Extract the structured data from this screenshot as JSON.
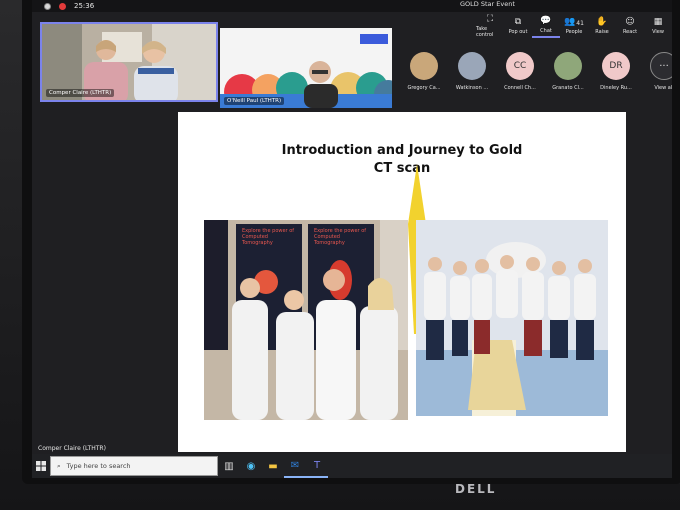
{
  "meeting": {
    "timer": "25:36",
    "title": "GOLD Star Event"
  },
  "toolbar": [
    {
      "label": "Take control",
      "icon": "take-control-icon",
      "glyph": "⛶",
      "active": false
    },
    {
      "label": "Pop out",
      "icon": "pop-out-icon",
      "glyph": "⧉",
      "active": false
    },
    {
      "label": "Chat",
      "icon": "chat-icon",
      "glyph": "💬",
      "active": true
    },
    {
      "label": "People",
      "icon": "people-icon",
      "glyph": "👥",
      "count": "41",
      "active": false
    },
    {
      "label": "Raise",
      "icon": "raise-hand-icon",
      "glyph": "✋",
      "active": false
    },
    {
      "label": "React",
      "icon": "react-icon",
      "glyph": "☺",
      "active": false
    },
    {
      "label": "View",
      "icon": "view-icon",
      "glyph": "▦",
      "active": false
    }
  ],
  "tiles": {
    "tile1_name": "Comper Claire (LTHTR)",
    "tile2_name": "O'Neill Paul (LTHTR)"
  },
  "participants": [
    {
      "name": "Gregory Ca...",
      "initials": "",
      "color": "#c9a77a"
    },
    {
      "name": "Watkinson ...",
      "initials": "",
      "color": "#9aa6b8"
    },
    {
      "name": "Connell Ch...",
      "initials": "CC",
      "color": "#f0c9c9"
    },
    {
      "name": "Granato Cl...",
      "initials": "",
      "color": "#8fa77a"
    },
    {
      "name": "Dineley Ru...",
      "initials": "DR",
      "color": "#f0c9c9"
    }
  ],
  "view_all": {
    "label": "View all",
    "glyph": "···"
  },
  "slide": {
    "title_line1": "Introduction and Journey to Gold",
    "title_line2": "CT scan",
    "poster1": "Explore the power of Computed Tomography",
    "poster2": "Explore the power of Computed Tomography"
  },
  "presenter_label": "Comper Claire (LTHTR)",
  "taskbar": {
    "search_placeholder": "Type here to search"
  },
  "brand": "DELL"
}
